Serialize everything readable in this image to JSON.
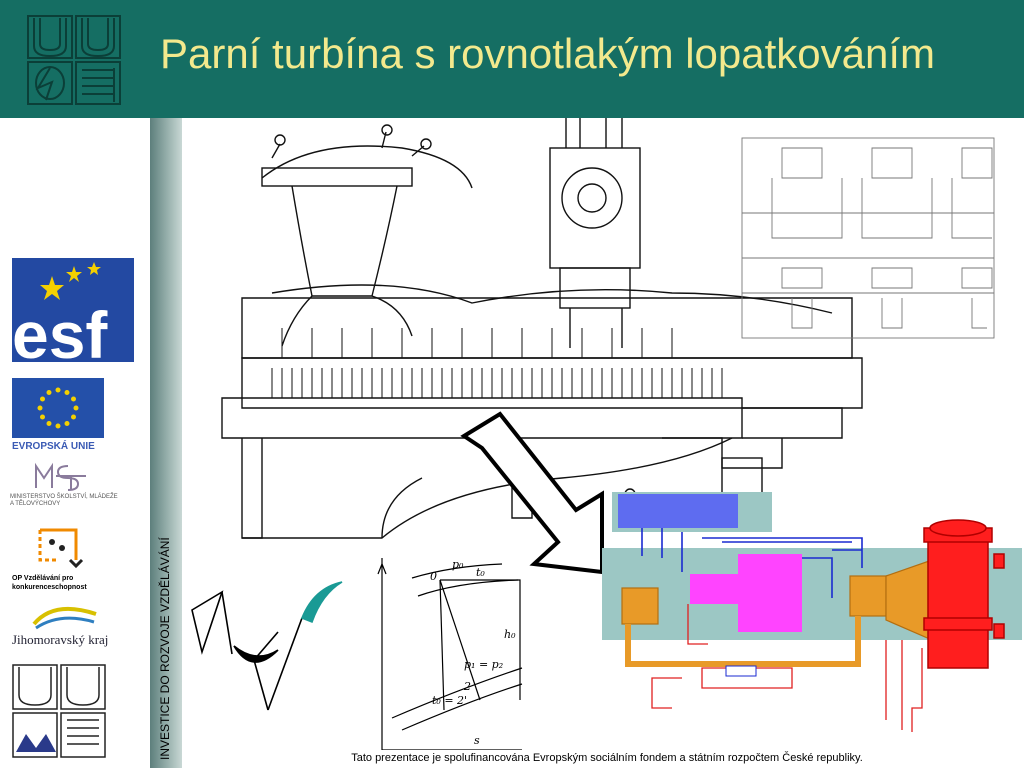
{
  "header": {
    "title": "Parní turbína s rovnotlakým lopatkováním",
    "bg_color": "#156e63",
    "title_color": "#f3e98d"
  },
  "sidebar": {
    "logos": [
      "esf-logo",
      "eu-flag-logo",
      "msmt-logo",
      "op-vk-logo",
      "jihomoravsky-kraj-logo",
      "vut-logo"
    ],
    "eu_label": "EVROPSKÁ UNIE",
    "msmt_label": "MINISTERSTVO ŠKOLSTVÍ, MLÁDEŽE A TĚLOVÝCHOVY",
    "op_label": "OP Vzdělávání pro konkurenceschopnost",
    "region_label": "Jihomoravský kraj",
    "vertical_text": "INVESTICE DO ROZVOJE VZDĚLÁVÁNÍ"
  },
  "footer": {
    "text": "Tato prezentace je spolufinancována Evropským sociálním fondem a státním rozpočtem České republiky."
  },
  "hs_diagram": {
    "labels": [
      "p₀",
      "t₀",
      "0",
      "h₀",
      "p₁ = p₂",
      "2",
      "t₀ = 2'",
      "s"
    ]
  }
}
